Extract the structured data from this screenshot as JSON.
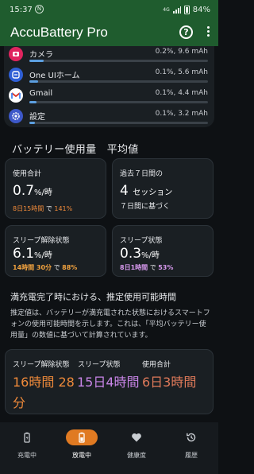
{
  "status_bar": {
    "time": "15:37",
    "network": "4G",
    "battery": "84%"
  },
  "app": {
    "title": "AccuBattery Pro"
  },
  "apps": [
    {
      "name": "カメラ",
      "usage": "0.2%, 9.6 mAh",
      "icon": "camera-icon",
      "color": "#e0245e",
      "fraction": 0.08
    },
    {
      "name": "One UIホーム",
      "usage": "0.1%, 5.6 mAh",
      "icon": "one-ui-home-icon",
      "color": "#2f5fd6",
      "fraction": 0.05
    },
    {
      "name": "Gmail",
      "usage": "0.1%, 4.4 mAh",
      "icon": "gmail-icon",
      "color": "#ffffff",
      "fraction": 0.04
    },
    {
      "name": "設定",
      "usage": "0.1%, 3.2 mAh",
      "icon": "settings-icon",
      "color": "#3d58c9",
      "fraction": 0.03
    }
  ],
  "battery_usage": {
    "title": "バッテリー使用量　平均値",
    "total": {
      "label": "使用合計",
      "value": "0.7",
      "unit": "%/時",
      "duration": "8日15時間",
      "mid": "で",
      "percent": "141%"
    },
    "week": {
      "label": "過去７日間の",
      "value": "4",
      "unit": "セッション",
      "note": "７日間に基づく"
    },
    "awake": {
      "label": "スリープ解除状態",
      "value": "6.1",
      "unit": "%/時",
      "duration": "14時間 30分",
      "mid": "で",
      "percent": "88%"
    },
    "sleep": {
      "label": "スリープ状態",
      "value": "0.3",
      "unit": "%/時",
      "duration": "8日1時間",
      "mid": "で",
      "percent": "53%"
    }
  },
  "estimate": {
    "title": "満充電完了時における、推定使用可能時間",
    "description": "推定値は、バッテリーが満充電された状態におけるスマートフォンの使用可能時間を示します。これは、「平均バッテリー使用量」の数値に基づいて計算されています。",
    "awake_label": "スリープ解除状態",
    "awake_value_line1": "16時間 28",
    "awake_value_line2": "分",
    "sleep_label": "スリープ状態",
    "sleep_value": "15日4時間",
    "combined_label": "使用合計",
    "combined_value": "6日3時間"
  },
  "nav": [
    {
      "label": "充電中",
      "icon": "charging-icon",
      "active": false
    },
    {
      "label": "放電中",
      "icon": "discharging-icon",
      "active": true
    },
    {
      "label": "健康度",
      "icon": "heart-icon",
      "active": false
    },
    {
      "label": "履歴",
      "icon": "history-icon",
      "active": false
    }
  ],
  "colors": {
    "header": "#1f5c2e",
    "accent": "#e07a22",
    "bar": "#5c9fe0",
    "awake": "#ef8a3a",
    "sleep": "#c985e8"
  }
}
